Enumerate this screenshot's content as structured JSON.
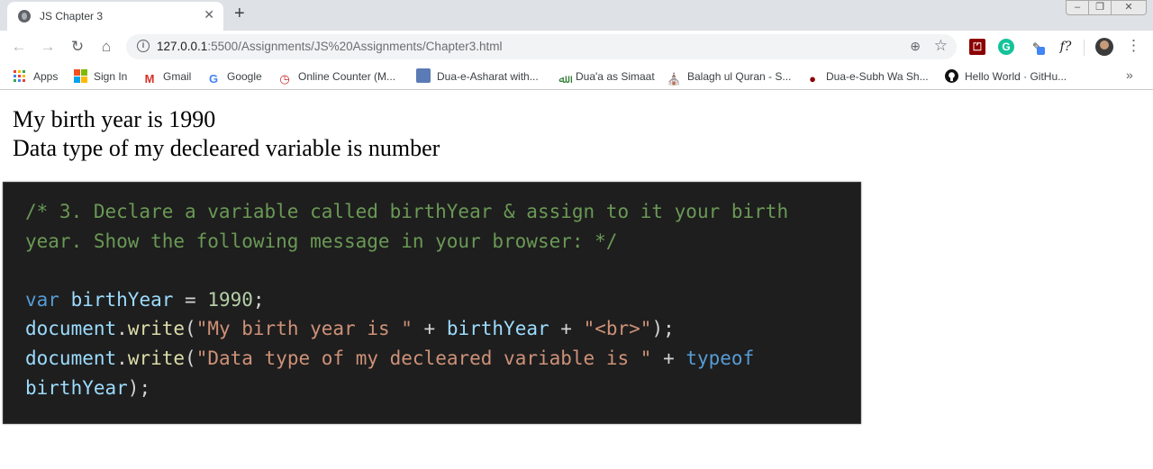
{
  "browser": {
    "tab": {
      "title": "JS Chapter 3",
      "close": "✕"
    },
    "new_tab": "+",
    "window_controls": {
      "minimize": "‒",
      "restore": "❐",
      "close": "✕"
    },
    "toolbar": {
      "back": "←",
      "forward": "→",
      "reload": "↻",
      "home": "⌂",
      "url_host": "127.0.0.1",
      "url_rest": ":5500/Assignments/JS%20Assignments/Chapter3.html",
      "info": "i",
      "zoom": "⊕",
      "star": "☆",
      "extensions": [
        "pdf-extension",
        "grammarly-extension",
        "pen-extension",
        "formula-extension"
      ],
      "formula_ext_label": "f?",
      "grammarly_label": "G",
      "menu": "⋮"
    },
    "bookmarks": [
      {
        "label": "Apps",
        "icon": "apps-grid-icon"
      },
      {
        "label": "Sign In",
        "icon": "windows-icon"
      },
      {
        "label": "Gmail",
        "icon": "gmail-icon"
      },
      {
        "label": "Google",
        "icon": "google-icon"
      },
      {
        "label": "Online Counter (M...",
        "icon": "counter-icon"
      },
      {
        "label": "Dua-e-Asharat with...",
        "icon": "mosque-image-icon"
      },
      {
        "label": "Dua'a as Simaat",
        "icon": "calligraphy-icon"
      },
      {
        "label": "Balagh ul Quran - S...",
        "icon": "shrine-icon"
      },
      {
        "label": "Dua-e-Subh Wa Sh...",
        "icon": "globe-icon"
      },
      {
        "label": "Hello World · GitHu...",
        "icon": "github-icon"
      }
    ],
    "bookmarks_more": "»"
  },
  "page": {
    "line1": "My birth year is 1990",
    "line2": "Data type of my decleared variable is number"
  },
  "code": {
    "comment": "/* 3. Declare a variable called birthYear & assign to it your birth year. Show the following message in your browser: */",
    "kw_var": "var",
    "var_name": "birthYear",
    "assign": " = ",
    "number": "1990",
    "semicolon": ";",
    "obj_document": "document",
    "dot": ".",
    "fn_write": "write",
    "paren_open": "(",
    "str1": "\"My birth year is \"",
    "plus": " + ",
    "str_br": "\"<br>\"",
    "paren_close_semi": ");",
    "str2": "\"Data type of my decleared variable is \"",
    "kw_typeof": "typeof"
  },
  "colors": {
    "code_bg": "#1e1e1e",
    "comment": "#6a9955",
    "keyword": "#569cd6",
    "variable": "#9cdcfe",
    "number": "#b5cea8",
    "function": "#dcdcaa",
    "string": "#ce9178"
  }
}
